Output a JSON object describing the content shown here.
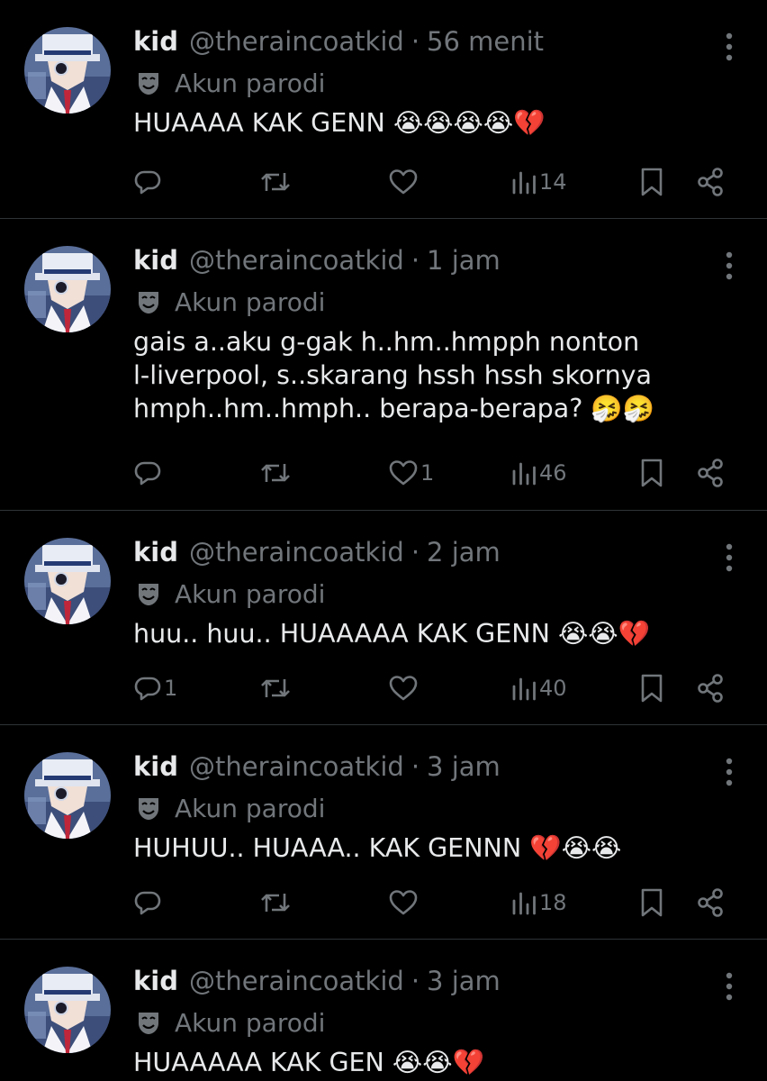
{
  "tweets": [
    {
      "name": "kid",
      "handle": "@theraincoatkid",
      "separator": "·",
      "time": "56 menit",
      "parody_label": "Akun parodi",
      "text": "HUAAAA KAK GENN 😭😭😭😭💔",
      "replies": "",
      "reposts": "",
      "likes": "",
      "views": "14"
    },
    {
      "name": "kid",
      "handle": "@theraincoatkid",
      "separator": "·",
      "time": "1 jam",
      "parody_label": "Akun parodi",
      "text": "gais a..aku g-gak h..hm..hmpph nonton\nl-liverpool, s..skarang hssh hssh skornya\nhmph..hm..hmph.. berapa-berapa? 🤧🤧",
      "replies": "",
      "reposts": "",
      "likes": "1",
      "views": "46"
    },
    {
      "name": "kid",
      "handle": "@theraincoatkid",
      "separator": "·",
      "time": "2 jam",
      "parody_label": "Akun parodi",
      "text": "huu.. huu.. HUAAAAA KAK GENN 😭😭💔",
      "replies": "1",
      "reposts": "",
      "likes": "",
      "views": "40"
    },
    {
      "name": "kid",
      "handle": "@theraincoatkid",
      "separator": "·",
      "time": "3 jam",
      "parody_label": "Akun parodi",
      "text": "HUHUU.. HUAAA.. KAK GENNN 💔😭😭",
      "replies": "",
      "reposts": "",
      "likes": "",
      "views": "18"
    },
    {
      "name": "kid",
      "handle": "@theraincoatkid",
      "separator": "·",
      "time": "3 jam",
      "parody_label": "Akun parodi",
      "text": "HUAAAAA KAK GEN 😭😭💔",
      "replies": "",
      "reposts": "",
      "likes": "",
      "views": ""
    }
  ],
  "icons": {
    "avatar": "anime-avatar-icon",
    "parody": "parody-mask-icon",
    "more": "more-options-icon",
    "reply": "reply-icon",
    "repost": "repost-icon",
    "like": "like-icon",
    "views": "views-icon",
    "bookmark": "bookmark-icon",
    "share": "share-icon"
  },
  "colors": {
    "background": "#000000",
    "primary_text": "#e7e9ea",
    "secondary_text": "#71767b",
    "divider": "#2f3336"
  }
}
